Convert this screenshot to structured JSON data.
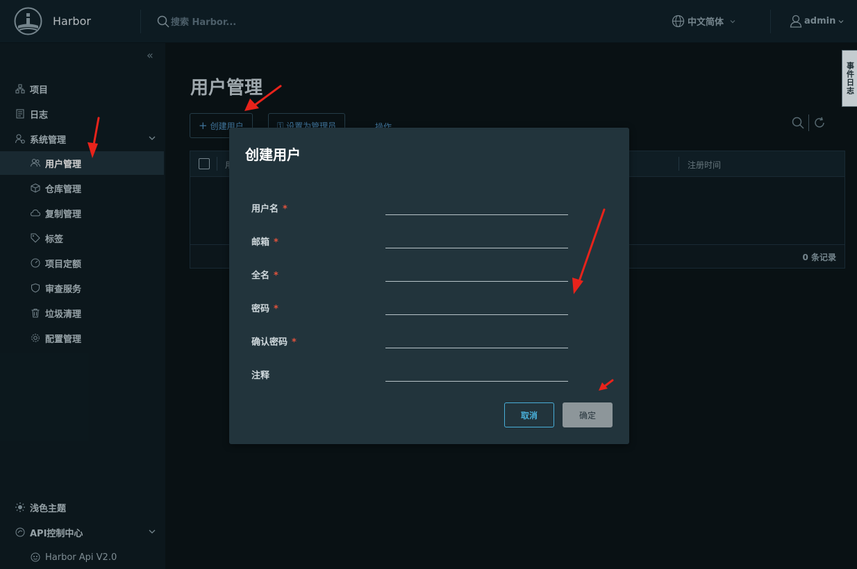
{
  "header": {
    "app_name": "Harbor",
    "search_placeholder": "搜索 Harbor...",
    "language": "中文简体",
    "user": "admin"
  },
  "sidebar": {
    "items": [
      {
        "label": "项目",
        "icon": "projects-icon"
      },
      {
        "label": "日志",
        "icon": "logs-icon"
      },
      {
        "label": "系统管理",
        "icon": "system-admin-icon"
      },
      {
        "label": "用户管理",
        "icon": "users-icon"
      },
      {
        "label": "仓库管理",
        "icon": "registries-icon"
      },
      {
        "label": "复制管理",
        "icon": "replication-icon"
      },
      {
        "label": "标签",
        "icon": "tag-icon"
      },
      {
        "label": "项目定额",
        "icon": "quota-icon"
      },
      {
        "label": "审查服务",
        "icon": "shield-icon"
      },
      {
        "label": "垃圾清理",
        "icon": "trash-icon"
      },
      {
        "label": "配置管理",
        "icon": "gear-icon"
      }
    ],
    "theme_label": "浅色主题",
    "api_center_label": "API控制中心",
    "api_item_label": "Harbor Api V2.0"
  },
  "main": {
    "title": "用户管理",
    "create_user_label": "创建用户",
    "set_admin_label": "设置为管理员",
    "actions_label": "操作",
    "columns": [
      "用",
      "注册时间"
    ],
    "record_count": "0 条记录"
  },
  "side_handle_label": "事件日志",
  "modal": {
    "title": "创建用户",
    "fields": [
      {
        "label": "用户名",
        "required": true,
        "value": ""
      },
      {
        "label": "邮箱",
        "required": true,
        "value": ""
      },
      {
        "label": "全名",
        "required": true,
        "value": ""
      },
      {
        "label": "密码",
        "required": true,
        "value": ""
      },
      {
        "label": "确认密码",
        "required": true,
        "value": ""
      },
      {
        "label": "注释",
        "required": false,
        "value": ""
      }
    ],
    "required_mark": "*",
    "cancel_label": "取消",
    "ok_label": "确定"
  },
  "colors": {
    "accent": "#49afd9",
    "modal_bg": "#22343c",
    "header_bg": "#11222a",
    "sidebar_bg": "#0f1d23",
    "annotation_arrow": "#e8231b"
  }
}
